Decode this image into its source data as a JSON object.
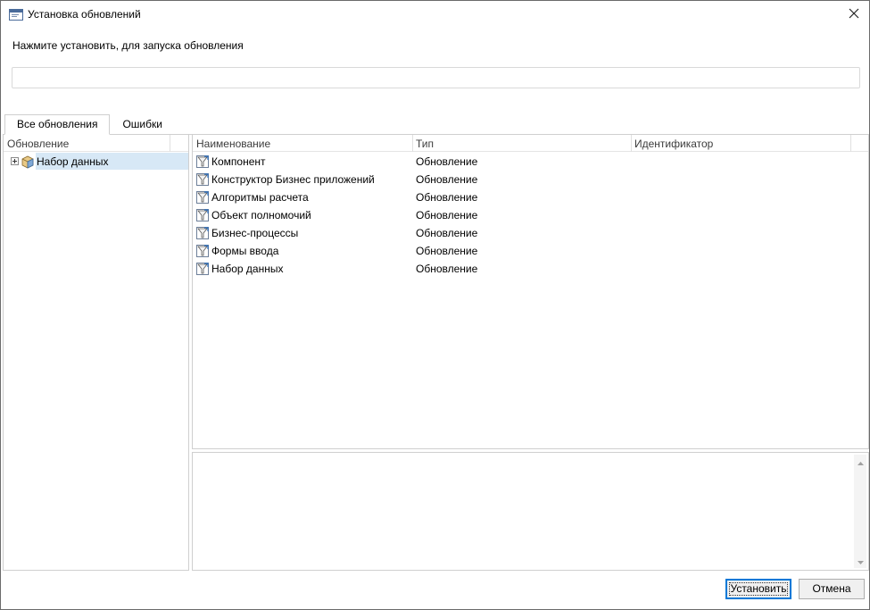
{
  "window": {
    "title": "Установка обновлений",
    "hint": "Нажмите установить, для запуска обновления",
    "progress": 0
  },
  "tabs": [
    {
      "label": "Все обновления",
      "active": true
    },
    {
      "label": "Ошибки",
      "active": false
    }
  ],
  "tree": {
    "column_header": "Обновление",
    "items": [
      {
        "label": "Набор данных",
        "icon": "package-icon",
        "selected": true,
        "expandable": true
      }
    ]
  },
  "grid": {
    "columns": [
      "Наименование",
      "Тип",
      "Идентификатор"
    ],
    "rows": [
      {
        "name": "Компонент",
        "type": "Обновление",
        "id": ""
      },
      {
        "name": "Конструктор Бизнес приложений",
        "type": "Обновление",
        "id": ""
      },
      {
        "name": "Алгоритмы расчета",
        "type": "Обновление",
        "id": ""
      },
      {
        "name": "Объект полномочий",
        "type": "Обновление",
        "id": ""
      },
      {
        "name": "Бизнес-процессы",
        "type": "Обновление",
        "id": ""
      },
      {
        "name": "Формы ввода",
        "type": "Обновление",
        "id": ""
      },
      {
        "name": "Набор данных",
        "type": "Обновление",
        "id": ""
      }
    ]
  },
  "buttons": {
    "install": "Установить",
    "cancel": "Отмена"
  },
  "colors": {
    "selection": "#d7e8f6",
    "focus_border": "#0078d7"
  }
}
